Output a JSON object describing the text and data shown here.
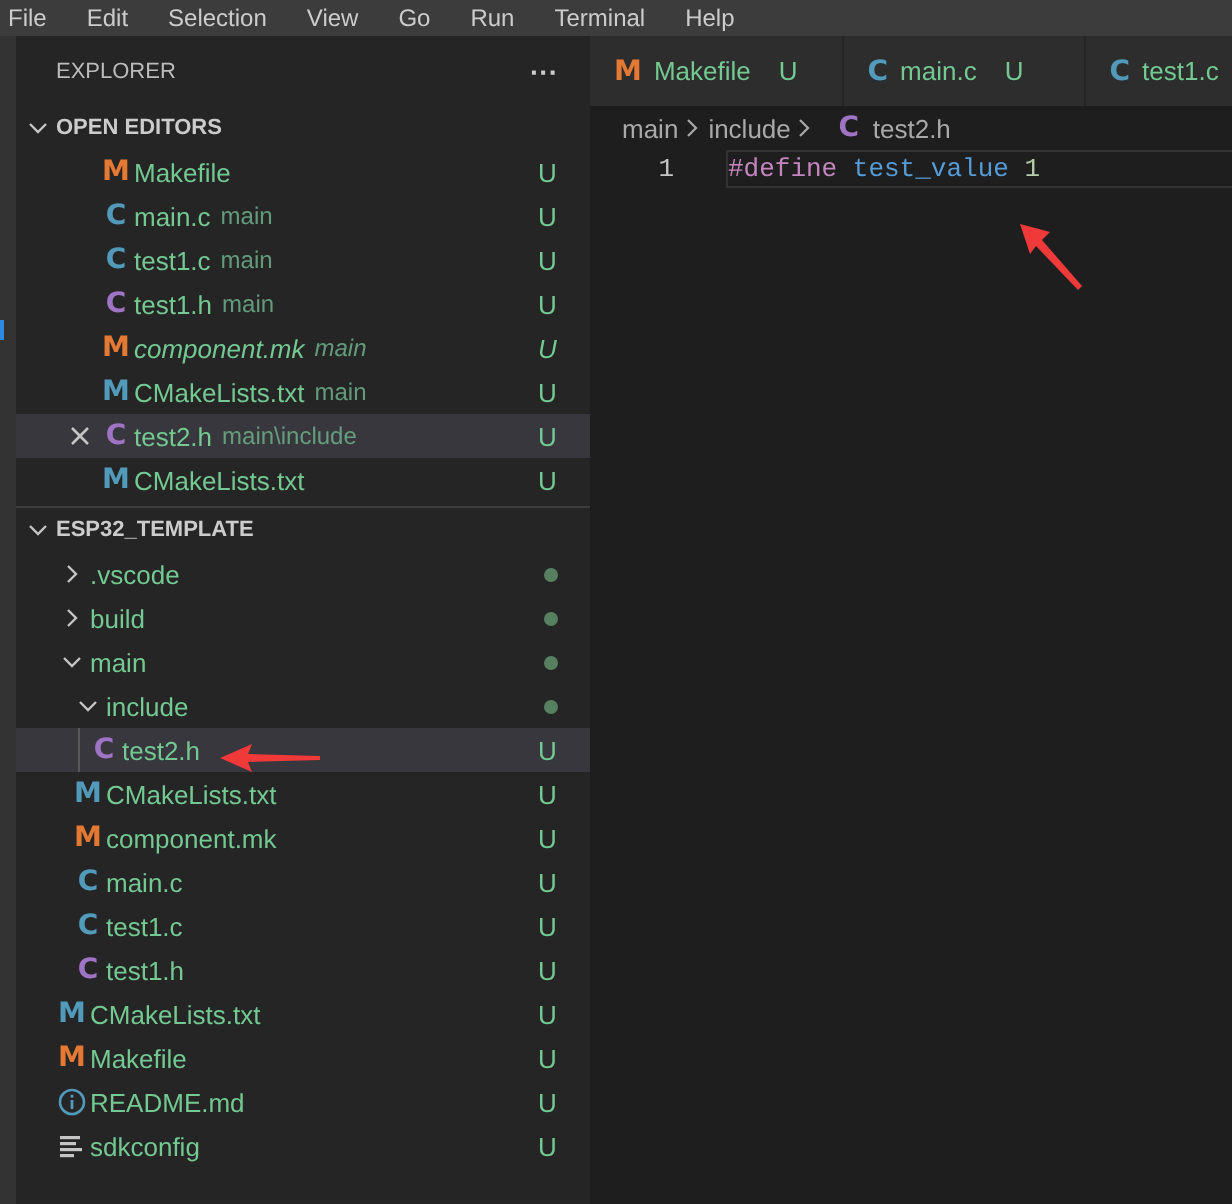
{
  "menu": [
    "File",
    "Edit",
    "Selection",
    "View",
    "Go",
    "Run",
    "Terminal",
    "Help"
  ],
  "explorer": {
    "title": "EXPLORER",
    "more": "···"
  },
  "open_editors": {
    "title": "OPEN EDITORS",
    "expanded": true,
    "items": [
      {
        "name": "Makefile",
        "icon": {
          "kind": "letter",
          "glyph": "M",
          "color": "#e37933"
        },
        "status": "U",
        "preview": false,
        "selected": false
      },
      {
        "name": "main.c",
        "description": "main",
        "icon": {
          "kind": "letter",
          "glyph": "C",
          "color": "#519aba"
        },
        "status": "U",
        "preview": false,
        "selected": false
      },
      {
        "name": "test1.c",
        "description": "main",
        "icon": {
          "kind": "letter",
          "glyph": "C",
          "color": "#519aba"
        },
        "status": "U",
        "preview": false,
        "selected": false
      },
      {
        "name": "test1.h",
        "description": "main",
        "icon": {
          "kind": "letter",
          "glyph": "C",
          "color": "#a074c4"
        },
        "status": "U",
        "preview": false,
        "selected": false
      },
      {
        "name": "component.mk",
        "description": "main",
        "icon": {
          "kind": "letter",
          "glyph": "M",
          "color": "#e37933"
        },
        "status": "U",
        "preview": true,
        "selected": false
      },
      {
        "name": "CMakeLists.txt",
        "description": "main",
        "icon": {
          "kind": "letter",
          "glyph": "M",
          "color": "#519aba"
        },
        "status": "U",
        "preview": false,
        "selected": false
      },
      {
        "name": "test2.h",
        "description": "main\\include",
        "icon": {
          "kind": "letter",
          "glyph": "C",
          "color": "#a074c4"
        },
        "status": "U",
        "preview": false,
        "selected": true
      },
      {
        "name": "CMakeLists.txt",
        "icon": {
          "kind": "letter",
          "glyph": "M",
          "color": "#519aba"
        },
        "status": "U",
        "preview": false,
        "selected": false
      }
    ]
  },
  "workspace": {
    "title": "ESP32_TEMPLATE",
    "expanded": true,
    "tree": [
      {
        "name": ".vscode",
        "kind": "folder",
        "expanded": false,
        "has_changes": true,
        "selected": false
      },
      {
        "name": "build",
        "kind": "folder",
        "expanded": false,
        "has_changes": true,
        "selected": false
      },
      {
        "name": "main",
        "kind": "folder",
        "expanded": true,
        "has_changes": true,
        "selected": false,
        "children": [
          {
            "name": "include",
            "kind": "folder",
            "expanded": true,
            "has_changes": true,
            "selected": false,
            "children": [
              {
                "name": "test2.h",
                "kind": "file",
                "icon": {
                  "kind": "letter",
                  "glyph": "C",
                  "color": "#a074c4"
                },
                "status": "U",
                "selected": true
              }
            ]
          },
          {
            "name": "CMakeLists.txt",
            "kind": "file",
            "icon": {
              "kind": "letter",
              "glyph": "M",
              "color": "#519aba"
            },
            "status": "U",
            "selected": false
          },
          {
            "name": "component.mk",
            "kind": "file",
            "icon": {
              "kind": "letter",
              "glyph": "M",
              "color": "#e37933"
            },
            "status": "U",
            "selected": false
          },
          {
            "name": "main.c",
            "kind": "file",
            "icon": {
              "kind": "letter",
              "glyph": "C",
              "color": "#519aba"
            },
            "status": "U",
            "selected": false
          },
          {
            "name": "test1.c",
            "kind": "file",
            "icon": {
              "kind": "letter",
              "glyph": "C",
              "color": "#519aba"
            },
            "status": "U",
            "selected": false
          },
          {
            "name": "test1.h",
            "kind": "file",
            "icon": {
              "kind": "letter",
              "glyph": "C",
              "color": "#a074c4"
            },
            "status": "U",
            "selected": false
          }
        ]
      },
      {
        "name": "CMakeLists.txt",
        "kind": "file",
        "icon": {
          "kind": "letter",
          "glyph": "M",
          "color": "#519aba"
        },
        "status": "U",
        "selected": false
      },
      {
        "name": "Makefile",
        "kind": "file",
        "icon": {
          "kind": "letter",
          "glyph": "M",
          "color": "#e37933"
        },
        "status": "U",
        "selected": false
      },
      {
        "name": "README.md",
        "kind": "file",
        "icon": {
          "kind": "info"
        },
        "status": "U",
        "selected": false
      },
      {
        "name": "sdkconfig",
        "kind": "file",
        "icon": {
          "kind": "lines"
        },
        "status": "U",
        "selected": false
      }
    ]
  },
  "tabs": [
    {
      "name": "Makefile",
      "status": "U",
      "icon": {
        "kind": "letter",
        "glyph": "M",
        "color": "#e37933"
      },
      "selected": false
    },
    {
      "name": "main.c",
      "status": "U",
      "icon": {
        "kind": "letter",
        "glyph": "C",
        "color": "#519aba"
      },
      "selected": false
    },
    {
      "name": "test1.c",
      "icon": {
        "kind": "letter",
        "glyph": "C",
        "color": "#519aba"
      },
      "selected": false
    }
  ],
  "breadcrumb": [
    {
      "kind": "folder",
      "label": "main"
    },
    {
      "kind": "folder",
      "label": "include"
    },
    {
      "kind": "file",
      "label": "test2.h",
      "icon": {
        "kind": "letter",
        "glyph": "C",
        "color": "#a074c4"
      }
    }
  ],
  "code_lines": [
    {
      "number": "1",
      "current": true,
      "tokens": [
        {
          "kind": "keyword",
          "text": "#define"
        },
        {
          "kind": "macro",
          "text": "test_value"
        },
        {
          "kind": "number",
          "text": "1"
        }
      ]
    }
  ]
}
